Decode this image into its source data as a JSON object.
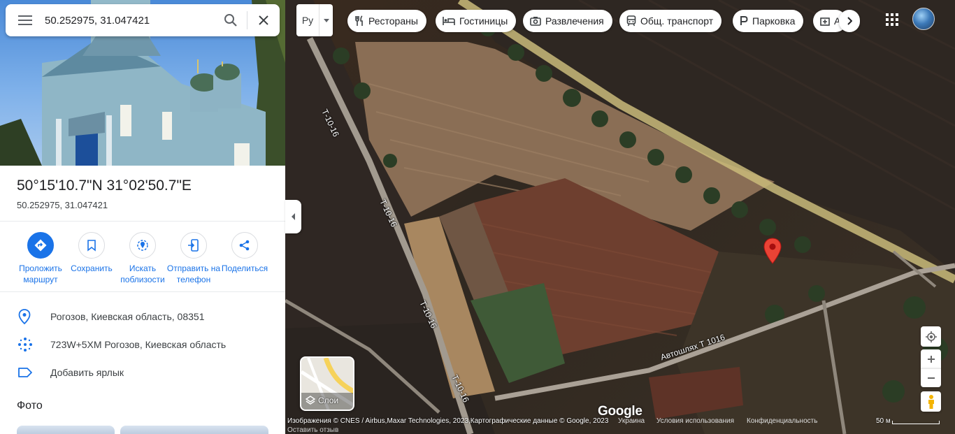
{
  "search": {
    "value": "50.252975, 31.047421"
  },
  "place": {
    "coords_dms": "50°15'10.7\"N 31°02'50.7\"E",
    "coords_decimal": "50.252975, 31.047421"
  },
  "actions": [
    {
      "label": "Проложить маршрут",
      "icon": "directions-icon"
    },
    {
      "label": "Сохранить",
      "icon": "bookmark-icon"
    },
    {
      "label": "Искать поблизости",
      "icon": "nearby-icon"
    },
    {
      "label": "Отправить на телефон",
      "icon": "send-to-phone-icon"
    },
    {
      "label": "Поделиться",
      "icon": "share-icon"
    }
  ],
  "info": {
    "address": "Рогозов, Киевская область, 08351",
    "plus_code": "723W+5XM Рогозов, Киевская область",
    "add_label": "Добавить ярлык"
  },
  "photos_heading": "Фото",
  "map": {
    "language": "Ру",
    "chips": [
      {
        "label": "Рестораны",
        "icon": "restaurant-icon"
      },
      {
        "label": "Гостиницы",
        "icon": "hotel-icon"
      },
      {
        "label": "Развлечения",
        "icon": "camera-icon"
      },
      {
        "label": "Общ. транспорт",
        "icon": "transit-icon"
      },
      {
        "label": "Парковка",
        "icon": "parking-icon"
      },
      {
        "label": "А",
        "icon": "pharmacy-icon"
      }
    ],
    "road_labels": [
      "Т-10-16",
      "Т-10-16",
      "Т-10-16",
      "Т-10-16",
      "Автошлях Т 1016"
    ],
    "layers_label": "Слои",
    "logo": "Google",
    "attribution": "Изображения © CNES / Airbus,Maxar Technologies, 2023,Картографические данные © Google, 2023",
    "footer_links": [
      "Украина",
      "Условия использования",
      "Конфиденциальность"
    ],
    "scale": "50 м",
    "feedback": "Оставить отзыв"
  },
  "colors": {
    "accent": "#1a73e8",
    "pin": "#ea4335"
  }
}
